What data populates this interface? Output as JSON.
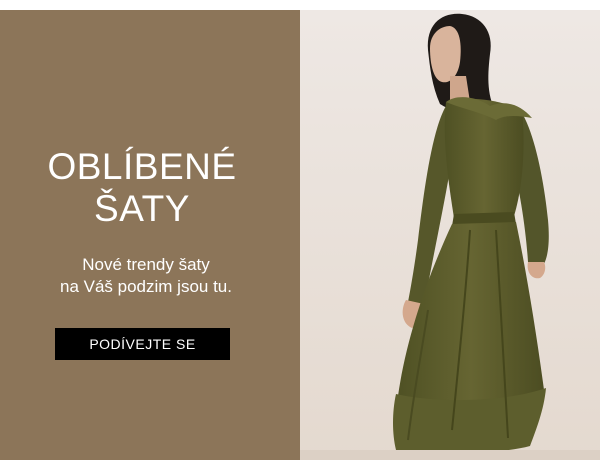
{
  "promo": {
    "headline_line1": "OBLÍBENÉ",
    "headline_line2": "ŠATY",
    "subtitle_line1": "Nové trendy šaty",
    "subtitle_line2": "na Váš podzim jsou tu.",
    "cta_label": "PODÍVEJTE SE"
  },
  "colors": {
    "panel_background": "#8c7559",
    "cta_background": "#000000",
    "dress": "#5f5f2c"
  },
  "photo": {
    "subject": "woman-in-olive-dress"
  }
}
